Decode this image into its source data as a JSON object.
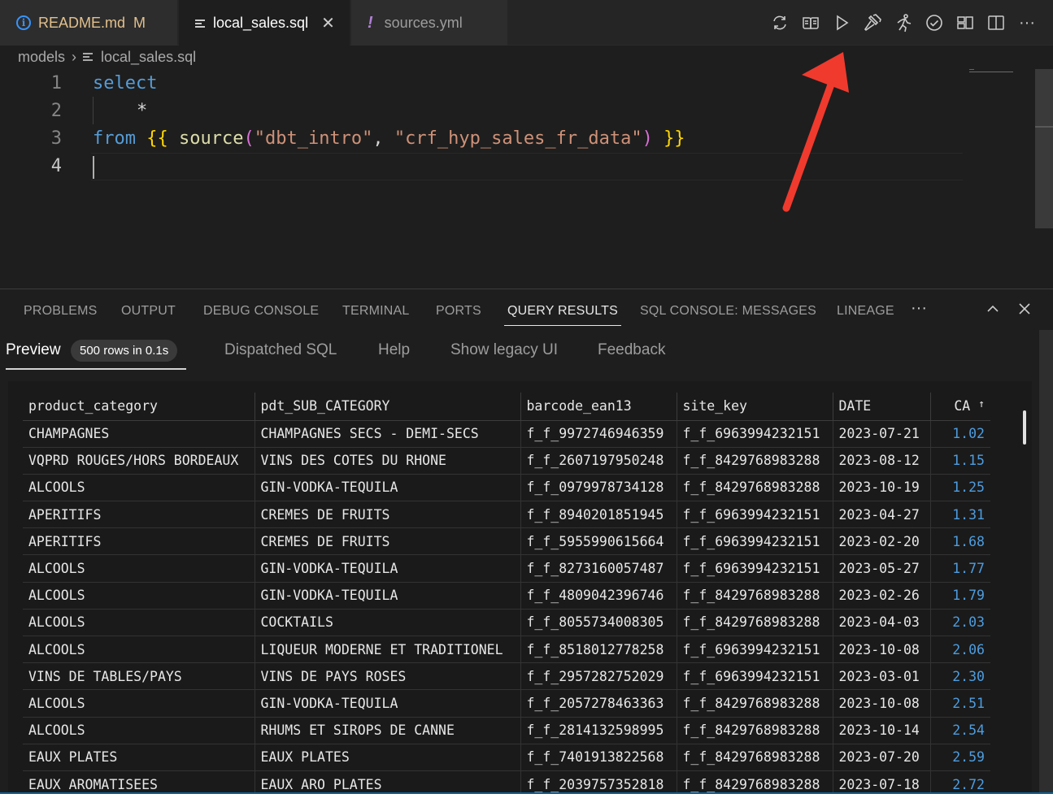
{
  "tabs": [
    {
      "label": "README.md",
      "flag": "M"
    },
    {
      "label": "local_sales.sql"
    },
    {
      "label": "sources.yml"
    }
  ],
  "breadcrumb": {
    "folder": "models",
    "file": "local_sales.sql"
  },
  "editor": {
    "line_numbers": [
      "1",
      "2",
      "3",
      "4"
    ],
    "code": {
      "select": "select",
      "star": "*",
      "from": "from",
      "open": "{{",
      "source_fn": "source",
      "lparen": "(",
      "arg1": "\"dbt_intro\"",
      "comma": ", ",
      "arg2": "\"crf_hyp_sales_fr_data\"",
      "rparen": ")",
      "close": "}}"
    }
  },
  "toolbar_icons": [
    "refresh-icon",
    "book-icon",
    "run-icon",
    "build-icon",
    "runner-icon",
    "check-icon",
    "layout-icon",
    "split-icon",
    "more-icon"
  ],
  "panel": {
    "tabs": [
      "PROBLEMS",
      "OUTPUT",
      "DEBUG CONSOLE",
      "TERMINAL",
      "PORTS",
      "QUERY RESULTS",
      "SQL CONSOLE: MESSAGES",
      "LINEAGE"
    ],
    "more": "···",
    "subtabs": {
      "preview": "Preview",
      "badge": "500 rows in 0.1s",
      "dispatched": "Dispatched SQL",
      "help": "Help",
      "legacy": "Show legacy UI",
      "feedback": "Feedback"
    }
  },
  "results": {
    "columns": [
      "product_category",
      "pdt_SUB_CATEGORY",
      "barcode_ean13",
      "site_key",
      "DATE",
      "CA"
    ],
    "sort_indicator": "↑",
    "rows": [
      [
        "CHAMPAGNES",
        "CHAMPAGNES SECS - DEMI-SECS",
        "f_f_9972746946359",
        "f_f_6963994232151",
        "2023-07-21",
        "1.02"
      ],
      [
        "VQPRD ROUGES/HORS BORDEAUX",
        "VINS DES COTES DU RHONE",
        "f_f_2607197950248",
        "f_f_8429768983288",
        "2023-08-12",
        "1.15"
      ],
      [
        "ALCOOLS",
        "GIN-VODKA-TEQUILA",
        "f_f_0979978734128",
        "f_f_8429768983288",
        "2023-10-19",
        "1.25"
      ],
      [
        "APERITIFS",
        "CREMES DE FRUITS",
        "f_f_8940201851945",
        "f_f_6963994232151",
        "2023-04-27",
        "1.31"
      ],
      [
        "APERITIFS",
        "CREMES DE FRUITS",
        "f_f_5955990615664",
        "f_f_6963994232151",
        "2023-02-20",
        "1.68"
      ],
      [
        "ALCOOLS",
        "GIN-VODKA-TEQUILA",
        "f_f_8273160057487",
        "f_f_6963994232151",
        "2023-05-27",
        "1.77"
      ],
      [
        "ALCOOLS",
        "GIN-VODKA-TEQUILA",
        "f_f_4809042396746",
        "f_f_8429768983288",
        "2023-02-26",
        "1.79"
      ],
      [
        "ALCOOLS",
        "COCKTAILS",
        "f_f_8055734008305",
        "f_f_8429768983288",
        "2023-04-03",
        "2.03"
      ],
      [
        "ALCOOLS",
        "LIQUEUR MODERNE ET TRADITIONEL",
        "f_f_8518012778258",
        "f_f_6963994232151",
        "2023-10-08",
        "2.06"
      ],
      [
        "VINS DE TABLES/PAYS",
        "VINS DE PAYS ROSES",
        "f_f_2957282752029",
        "f_f_6963994232151",
        "2023-03-01",
        "2.30"
      ],
      [
        "ALCOOLS",
        "GIN-VODKA-TEQUILA",
        "f_f_2057278463363",
        "f_f_8429768983288",
        "2023-10-08",
        "2.51"
      ],
      [
        "ALCOOLS",
        "RHUMS ET SIROPS DE CANNE",
        "f_f_2814132598995",
        "f_f_8429768983288",
        "2023-10-14",
        "2.54"
      ],
      [
        "EAUX PLATES",
        "EAUX PLATES",
        "f_f_7401913822568",
        "f_f_8429768983288",
        "2023-07-20",
        "2.59"
      ],
      [
        "EAUX AROMATISEES",
        "EAUX ARO PLATES",
        "f_f_2039757352818",
        "f_f_8429768983288",
        "2023-07-18",
        "2.72"
      ]
    ]
  },
  "colors": {
    "accent": "#0e639c",
    "arrow": "#f03a2e",
    "number": "#4d9de0"
  }
}
